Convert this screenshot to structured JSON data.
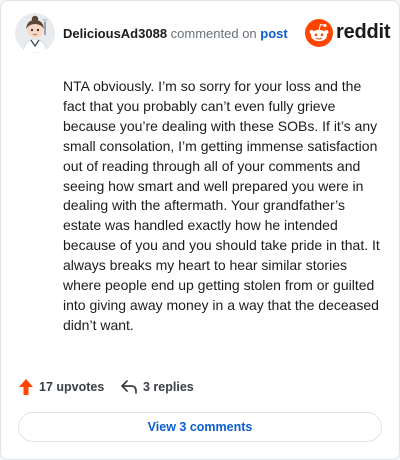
{
  "comment": {
    "author": "DeliciousAd3088",
    "action_text": "commented on",
    "post_link": "post",
    "body": "NTA obviously. I’m so sorry for your loss and the fact that you probably can’t even fully grieve because you’re dealing with these SOBs. If it’s any small consolation, I’m getting immense satisfaction out of reading through all of your comments and seeing how smart and well prepared you were in dealing with the aftermath. Your grandfather’s estate was handled exactly how he intended because of you and you should take pride in that. It always breaks my heart to hear similar stories where people end up getting stolen from or guilted into giving away money in a way that the deceased didn’t want."
  },
  "brand": {
    "wordmark": "reddit",
    "icon": "reddit-snoo-icon",
    "color": "#ff4500"
  },
  "actions": {
    "upvotes_label": "17 upvotes",
    "upvote_icon": "upvote-arrow-icon",
    "upvote_color": "#ff4500",
    "replies_label": "3 replies",
    "reply_icon": "reply-arrow-icon"
  },
  "footer": {
    "view_comments_label": "View 3 comments"
  },
  "colors": {
    "link": "#0b5dd0",
    "text": "#1c1c1c",
    "muted": "#6a7077"
  }
}
